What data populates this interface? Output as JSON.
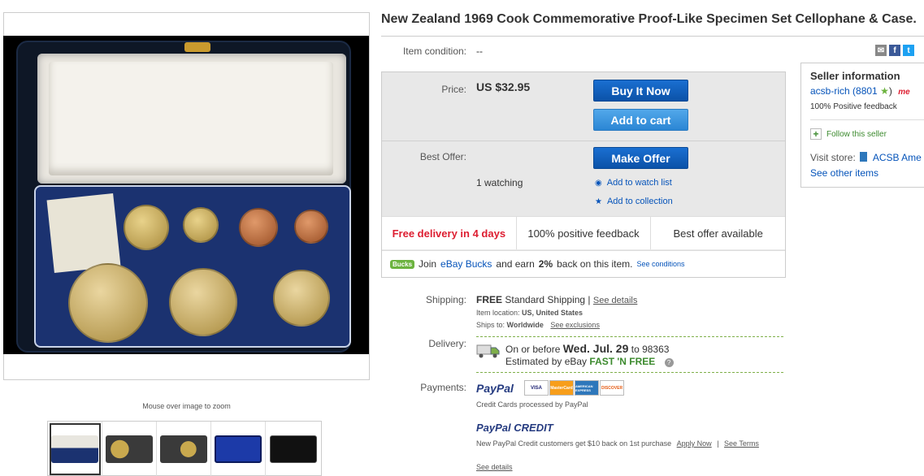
{
  "listing": {
    "title": "New Zealand 1969 Cook Commemorative Proof-Like Specimen Set Cellophane & Case.",
    "zoom_caption": "Mouse over image to zoom",
    "thumbnails": [
      "thumbnail-1",
      "thumbnail-2",
      "thumbnail-3",
      "thumbnail-4",
      "thumbnail-5"
    ]
  },
  "condition": {
    "label": "Item condition:",
    "value": "--"
  },
  "price": {
    "label": "Price:",
    "value": "US $32.95"
  },
  "buttons": {
    "buy_now": "Buy It Now",
    "add_to_cart": "Add to cart",
    "make_offer": "Make Offer"
  },
  "offer": {
    "label": "Best Offer:",
    "watching": "1 watching",
    "watch_link": "Add to watch list",
    "collection_link": "Add to collection"
  },
  "badges": [
    "Free delivery in 4 days",
    "100% positive feedback",
    "Best offer available"
  ],
  "bucks": {
    "logo": "Bucks",
    "pre": "Join",
    "link": "eBay Bucks",
    "mid": "and earn",
    "pct": "2%",
    "post": "back on this item.",
    "conditions": "See conditions"
  },
  "shipping": {
    "label": "Shipping:",
    "free": "FREE",
    "method": "Standard Shipping |",
    "details": "See details",
    "loc_label": "Item location:",
    "loc_value": "US, United States",
    "ships_label": "Ships to:",
    "ships_value": "Worldwide",
    "exclusions": "See exclusions"
  },
  "delivery": {
    "label": "Delivery:",
    "pre": "On or before",
    "date": "Wed. Jul. 29",
    "to": "to 98363",
    "estimated": "Estimated by eBay",
    "fast": "FAST 'N FREE",
    "help": "?"
  },
  "payments": {
    "label": "Payments:",
    "paypal": "PayPal",
    "cards": [
      "VISA",
      "MasterCard",
      "AMERICAN EXPRESS",
      "DISCOVER"
    ],
    "processed": "Credit Cards processed by PayPal",
    "credit_logo": "PayPal CREDIT",
    "credit_text": "New PayPal Credit customers get $10 back on 1st purchase",
    "apply": "Apply Now",
    "sep": "|",
    "terms": "See Terms",
    "details": "See details"
  },
  "seller": {
    "heading": "Seller information",
    "name": "acsb-rich",
    "score": "(8801",
    "star": "★",
    "close": ")",
    "me_badge": "me",
    "feedback": "100% Positive feedback",
    "follow_icon": "+",
    "follow": "Follow this seller",
    "visit_label": "Visit store:",
    "store": "ACSB Ame",
    "other": "See other items"
  },
  "share": [
    "email-icon",
    "facebook-icon",
    "twitter-icon"
  ],
  "colors": {
    "link": "#0654ba",
    "button": "#0b52a8",
    "red": "#dd1e31",
    "green": "#6cb33f"
  }
}
